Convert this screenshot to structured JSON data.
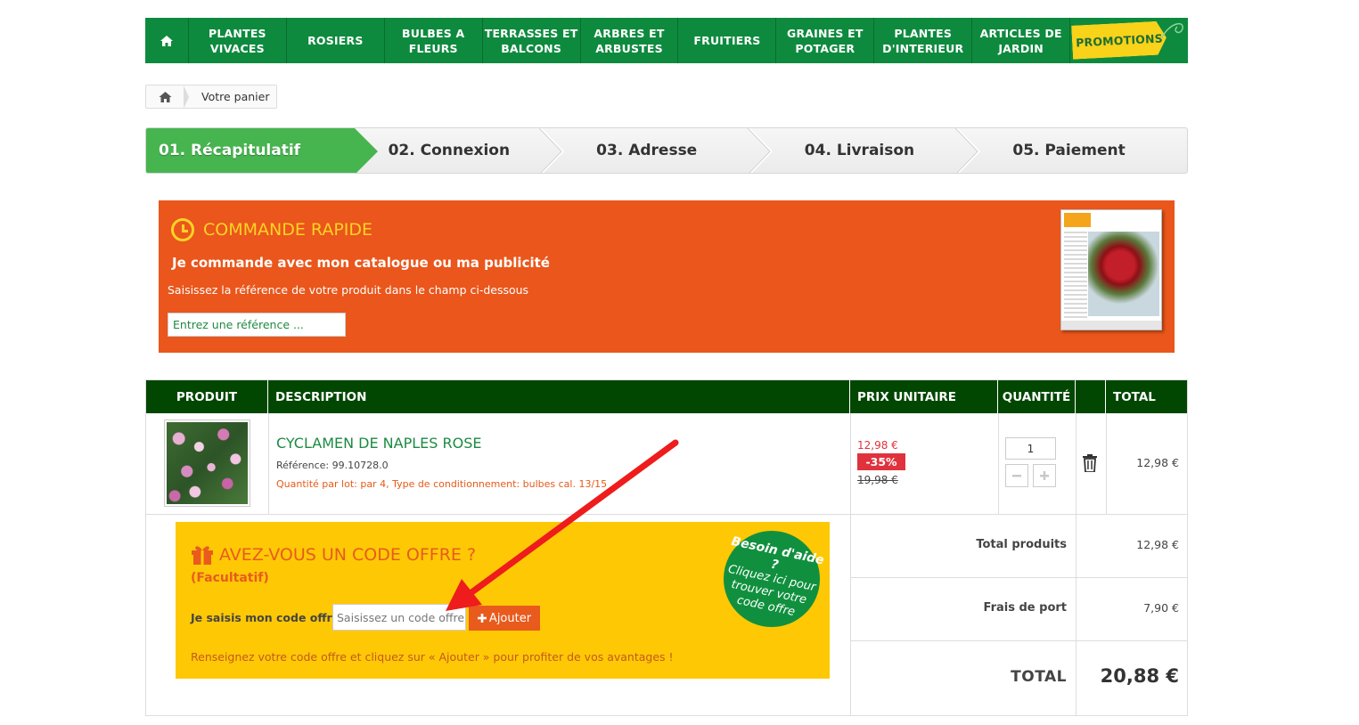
{
  "nav": {
    "home_icon": "home-icon",
    "items": [
      "PLANTES\nVIVACES",
      "ROSIERS",
      "BULBES A\nFLEURS",
      "TERRASSES ET\nBALCONS",
      "ARBRES ET\nARBUSTES",
      "FRUITIERS",
      "GRAINES ET\nPOTAGER",
      "PLANTES\nD'INTERIEUR",
      "ARTICLES DE\nJARDIN"
    ],
    "promo": "PROMOTIONS"
  },
  "breadcrumb": {
    "current": "Votre panier"
  },
  "steps": [
    "01. Récapitulatif",
    "02. Connexion",
    "03. Adresse",
    "04. Livraison",
    "05. Paiement"
  ],
  "quick_order": {
    "title": "COMMANDE RAPIDE",
    "subtitle": "Je commande avec mon catalogue ou ma publicité",
    "hint": "Saisissez la référence de votre produit dans le champ ci-dessous",
    "placeholder": "Entrez une référence ..."
  },
  "table": {
    "headers": [
      "PRODUIT",
      "DESCRIPTION",
      "PRIX UNITAIRE",
      "QUANTITÉ",
      "TOTAL"
    ],
    "row": {
      "name": "CYCLAMEN DE NAPLES ROSE",
      "reference": "Référence: 99.10728.0",
      "details": "Quantité par lot: par 4, Type de conditionnement: bulbes cal. 13/15",
      "price": "12,98 €",
      "discount": "-35%",
      "old_price": "19,98 €",
      "quantity": "1",
      "total": "12,98 €"
    }
  },
  "offer": {
    "title": "AVEZ-VOUS UN CODE OFFRE ?",
    "subtitle": "(Facultatif)",
    "label": "Je saisis mon code offre :",
    "placeholder": "Saisissez un code offre",
    "button": "Ajouter",
    "hint": "Renseignez votre code offre et cliquez sur « Ajouter » pour profiter de vos avantages !",
    "help_title": "Besoin d'aide ?",
    "help_body": "Cliquez ici pour\ntrouver votre\ncode offre"
  },
  "summary": {
    "products_label": "Total produits",
    "products_value": "12,98 €",
    "shipping_label": "Frais de port",
    "shipping_value": "7,90 €",
    "total_label": "TOTAL",
    "total_value": "20,88 €"
  },
  "colors": {
    "nav_green": "#0e8a3e",
    "header_dark_green": "#014701",
    "step_active": "#47b54f",
    "orange": "#ea561b",
    "yellow": "#fec805",
    "discount_red": "#e0323d",
    "arrow_red": "#ee1c1c"
  }
}
